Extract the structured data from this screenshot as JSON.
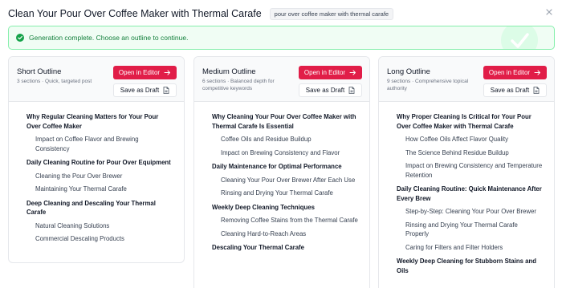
{
  "header": {
    "title": "Clean Your Pour Over Coffee Maker with Thermal Carafe",
    "keyword": "pour over coffee maker with thermal carafe"
  },
  "banner": {
    "message": "Generation complete. Choose an outline to continue."
  },
  "columns": [
    {
      "title": "Short Outline",
      "description": "3 sections · Quick, targeted post",
      "open_label": "Open in Editor",
      "draft_label": "Save as Draft",
      "items": [
        {
          "level": 2,
          "text": "Why Regular Cleaning Matters for Your Pour Over Coffee Maker"
        },
        {
          "level": 3,
          "text": "Impact on Coffee Flavor and Brewing Consistency"
        },
        {
          "level": 2,
          "text": "Daily Cleaning Routine for Pour Over Equipment"
        },
        {
          "level": 3,
          "text": "Cleaning the Pour Over Brewer"
        },
        {
          "level": 3,
          "text": "Maintaining Your Thermal Carafe"
        },
        {
          "level": 2,
          "text": "Deep Cleaning and Descaling Your Thermal Carafe"
        },
        {
          "level": 3,
          "text": "Natural Cleaning Solutions"
        },
        {
          "level": 3,
          "text": "Commercial Descaling Products"
        }
      ]
    },
    {
      "title": "Medium Outline",
      "description": "6 sections · Balanced depth for competitive keywords",
      "open_label": "Open in Editor",
      "draft_label": "Save as Draft",
      "items": [
        {
          "level": 2,
          "text": "Why Cleaning Your Pour Over Coffee Maker with Thermal Carafe Is Essential"
        },
        {
          "level": 3,
          "text": "Coffee Oils and Residue Buildup"
        },
        {
          "level": 3,
          "text": "Impact on Brewing Consistency and Flavor"
        },
        {
          "level": 2,
          "text": "Daily Maintenance for Optimal Performance"
        },
        {
          "level": 3,
          "text": "Cleaning Your Pour Over Brewer After Each Use"
        },
        {
          "level": 3,
          "text": "Rinsing and Drying Your Thermal Carafe"
        },
        {
          "level": 2,
          "text": "Weekly Deep Cleaning Techniques"
        },
        {
          "level": 3,
          "text": "Removing Coffee Stains from the Thermal Carafe"
        },
        {
          "level": 3,
          "text": "Cleaning Hard-to-Reach Areas"
        },
        {
          "level": 2,
          "text": "Descaling Your Thermal Carafe"
        }
      ]
    },
    {
      "title": "Long Outline",
      "description": "9 sections · Comprehensive topical authority",
      "open_label": "Open in Editor",
      "draft_label": "Save as Draft",
      "items": [
        {
          "level": 2,
          "text": "Why Proper Cleaning Is Critical for Your Pour Over Coffee Maker with Thermal Carafe"
        },
        {
          "level": 3,
          "text": "How Coffee Oils Affect Flavor Quality"
        },
        {
          "level": 3,
          "text": "The Science Behind Residue Buildup"
        },
        {
          "level": 3,
          "text": "Impact on Brewing Consistency and Temperature Retention"
        },
        {
          "level": 2,
          "text": "Daily Cleaning Routine: Quick Maintenance After Every Brew"
        },
        {
          "level": 3,
          "text": "Step-by-Step: Cleaning Your Pour Over Brewer"
        },
        {
          "level": 3,
          "text": "Rinsing and Drying Your Thermal Carafe Properly"
        },
        {
          "level": 3,
          "text": "Caring for Filters and Filter Holders"
        },
        {
          "level": 2,
          "text": "Weekly Deep Cleaning for Stubborn Stains and Oils"
        }
      ]
    }
  ],
  "icons": {
    "close": "close-icon",
    "success": "check-circle-icon",
    "open": "arrow-right-icon",
    "draft": "document-icon"
  },
  "colors": {
    "accent": "#e11d48",
    "success_text": "#15803d",
    "success_bg": "#f0fdf4",
    "success_border": "#86efac"
  }
}
